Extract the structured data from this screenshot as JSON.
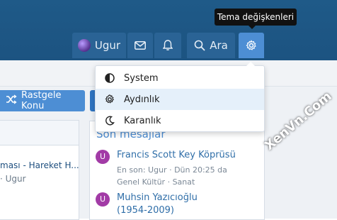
{
  "tooltip": "Tema değişkenleri",
  "nav": {
    "username": "Ugur",
    "search_label": "Ara"
  },
  "buttons": {
    "random_topic": "Rastgele Konu"
  },
  "theme_menu": {
    "items": [
      {
        "label": "System",
        "icon": "half-circle-icon"
      },
      {
        "label": "Aydınlık",
        "icon": "sun-gear-icon"
      },
      {
        "label": "Karanlık",
        "icon": "moon-icon"
      }
    ]
  },
  "left_panel": {
    "line1": "ması - Hareket H...",
    "line2": "· Ugur"
  },
  "recent_posts": {
    "title": "Son mesajlar",
    "items": [
      {
        "avatar": "U",
        "title": "Francis Scott Key Köprüsü",
        "meta1": "En son: Ugur · Dün 20:25 da",
        "meta2": "Genel Kültür · Sanat"
      },
      {
        "avatar": "U",
        "title": "Muhsin Yazıcıoğlu",
        "meta1": "(1954-2009)"
      }
    ]
  },
  "watermark": "XenVn.Com",
  "colors": {
    "header": "#1c5381",
    "accent": "#4d8ed4",
    "avatar_purple": "#a23ba6"
  }
}
